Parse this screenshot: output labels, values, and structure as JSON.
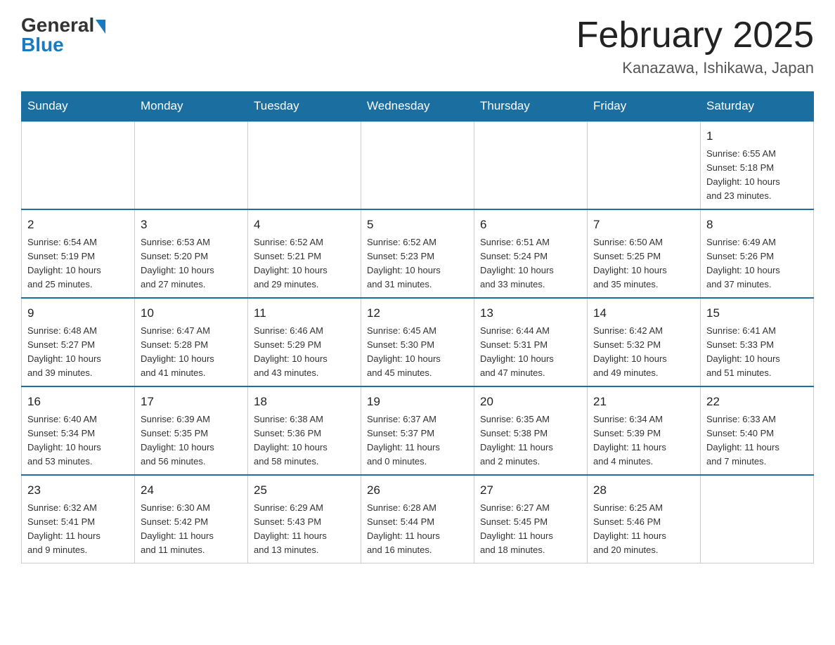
{
  "header": {
    "logo_general": "General",
    "logo_blue": "Blue",
    "month_title": "February 2025",
    "location": "Kanazawa, Ishikawa, Japan"
  },
  "weekdays": [
    "Sunday",
    "Monday",
    "Tuesday",
    "Wednesday",
    "Thursday",
    "Friday",
    "Saturday"
  ],
  "weeks": [
    [
      {
        "day": "",
        "info": ""
      },
      {
        "day": "",
        "info": ""
      },
      {
        "day": "",
        "info": ""
      },
      {
        "day": "",
        "info": ""
      },
      {
        "day": "",
        "info": ""
      },
      {
        "day": "",
        "info": ""
      },
      {
        "day": "1",
        "info": "Sunrise: 6:55 AM\nSunset: 5:18 PM\nDaylight: 10 hours\nand 23 minutes."
      }
    ],
    [
      {
        "day": "2",
        "info": "Sunrise: 6:54 AM\nSunset: 5:19 PM\nDaylight: 10 hours\nand 25 minutes."
      },
      {
        "day": "3",
        "info": "Sunrise: 6:53 AM\nSunset: 5:20 PM\nDaylight: 10 hours\nand 27 minutes."
      },
      {
        "day": "4",
        "info": "Sunrise: 6:52 AM\nSunset: 5:21 PM\nDaylight: 10 hours\nand 29 minutes."
      },
      {
        "day": "5",
        "info": "Sunrise: 6:52 AM\nSunset: 5:23 PM\nDaylight: 10 hours\nand 31 minutes."
      },
      {
        "day": "6",
        "info": "Sunrise: 6:51 AM\nSunset: 5:24 PM\nDaylight: 10 hours\nand 33 minutes."
      },
      {
        "day": "7",
        "info": "Sunrise: 6:50 AM\nSunset: 5:25 PM\nDaylight: 10 hours\nand 35 minutes."
      },
      {
        "day": "8",
        "info": "Sunrise: 6:49 AM\nSunset: 5:26 PM\nDaylight: 10 hours\nand 37 minutes."
      }
    ],
    [
      {
        "day": "9",
        "info": "Sunrise: 6:48 AM\nSunset: 5:27 PM\nDaylight: 10 hours\nand 39 minutes."
      },
      {
        "day": "10",
        "info": "Sunrise: 6:47 AM\nSunset: 5:28 PM\nDaylight: 10 hours\nand 41 minutes."
      },
      {
        "day": "11",
        "info": "Sunrise: 6:46 AM\nSunset: 5:29 PM\nDaylight: 10 hours\nand 43 minutes."
      },
      {
        "day": "12",
        "info": "Sunrise: 6:45 AM\nSunset: 5:30 PM\nDaylight: 10 hours\nand 45 minutes."
      },
      {
        "day": "13",
        "info": "Sunrise: 6:44 AM\nSunset: 5:31 PM\nDaylight: 10 hours\nand 47 minutes."
      },
      {
        "day": "14",
        "info": "Sunrise: 6:42 AM\nSunset: 5:32 PM\nDaylight: 10 hours\nand 49 minutes."
      },
      {
        "day": "15",
        "info": "Sunrise: 6:41 AM\nSunset: 5:33 PM\nDaylight: 10 hours\nand 51 minutes."
      }
    ],
    [
      {
        "day": "16",
        "info": "Sunrise: 6:40 AM\nSunset: 5:34 PM\nDaylight: 10 hours\nand 53 minutes."
      },
      {
        "day": "17",
        "info": "Sunrise: 6:39 AM\nSunset: 5:35 PM\nDaylight: 10 hours\nand 56 minutes."
      },
      {
        "day": "18",
        "info": "Sunrise: 6:38 AM\nSunset: 5:36 PM\nDaylight: 10 hours\nand 58 minutes."
      },
      {
        "day": "19",
        "info": "Sunrise: 6:37 AM\nSunset: 5:37 PM\nDaylight: 11 hours\nand 0 minutes."
      },
      {
        "day": "20",
        "info": "Sunrise: 6:35 AM\nSunset: 5:38 PM\nDaylight: 11 hours\nand 2 minutes."
      },
      {
        "day": "21",
        "info": "Sunrise: 6:34 AM\nSunset: 5:39 PM\nDaylight: 11 hours\nand 4 minutes."
      },
      {
        "day": "22",
        "info": "Sunrise: 6:33 AM\nSunset: 5:40 PM\nDaylight: 11 hours\nand 7 minutes."
      }
    ],
    [
      {
        "day": "23",
        "info": "Sunrise: 6:32 AM\nSunset: 5:41 PM\nDaylight: 11 hours\nand 9 minutes."
      },
      {
        "day": "24",
        "info": "Sunrise: 6:30 AM\nSunset: 5:42 PM\nDaylight: 11 hours\nand 11 minutes."
      },
      {
        "day": "25",
        "info": "Sunrise: 6:29 AM\nSunset: 5:43 PM\nDaylight: 11 hours\nand 13 minutes."
      },
      {
        "day": "26",
        "info": "Sunrise: 6:28 AM\nSunset: 5:44 PM\nDaylight: 11 hours\nand 16 minutes."
      },
      {
        "day": "27",
        "info": "Sunrise: 6:27 AM\nSunset: 5:45 PM\nDaylight: 11 hours\nand 18 minutes."
      },
      {
        "day": "28",
        "info": "Sunrise: 6:25 AM\nSunset: 5:46 PM\nDaylight: 11 hours\nand 20 minutes."
      },
      {
        "day": "",
        "info": ""
      }
    ]
  ]
}
